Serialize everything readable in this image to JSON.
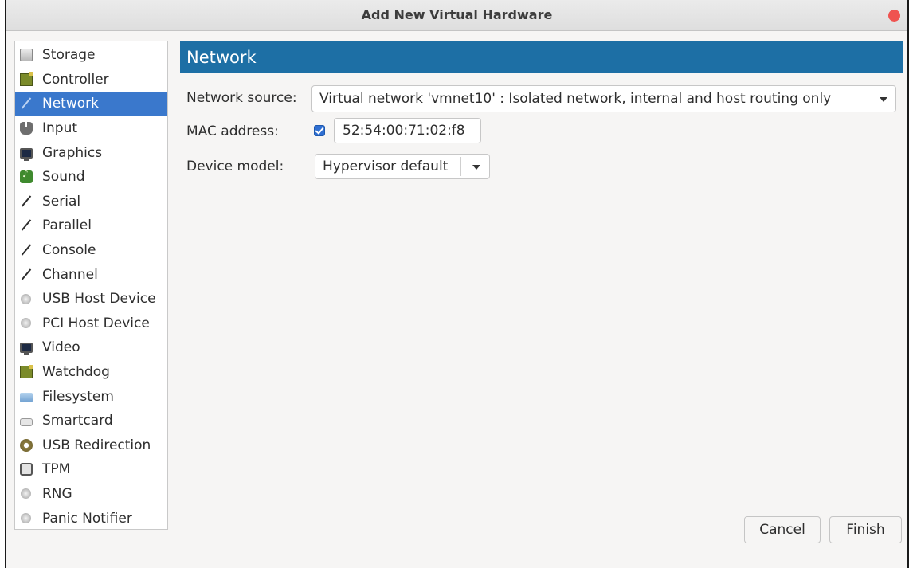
{
  "window": {
    "title": "Add New Virtual Hardware",
    "close_color": "#ef5350"
  },
  "sidebar": {
    "items": [
      {
        "label": "Storage",
        "icon": "storage-icon",
        "selected": false
      },
      {
        "label": "Controller",
        "icon": "controller-icon",
        "selected": false
      },
      {
        "label": "Network",
        "icon": "network-icon",
        "selected": true
      },
      {
        "label": "Input",
        "icon": "input-icon",
        "selected": false
      },
      {
        "label": "Graphics",
        "icon": "graphics-icon",
        "selected": false
      },
      {
        "label": "Sound",
        "icon": "sound-icon",
        "selected": false
      },
      {
        "label": "Serial",
        "icon": "serial-icon",
        "selected": false
      },
      {
        "label": "Parallel",
        "icon": "parallel-icon",
        "selected": false
      },
      {
        "label": "Console",
        "icon": "console-icon",
        "selected": false
      },
      {
        "label": "Channel",
        "icon": "channel-icon",
        "selected": false
      },
      {
        "label": "USB Host Device",
        "icon": "usb-host-device-icon",
        "selected": false
      },
      {
        "label": "PCI Host Device",
        "icon": "pci-host-device-icon",
        "selected": false
      },
      {
        "label": "Video",
        "icon": "video-icon",
        "selected": false
      },
      {
        "label": "Watchdog",
        "icon": "watchdog-icon",
        "selected": false
      },
      {
        "label": "Filesystem",
        "icon": "filesystem-icon",
        "selected": false
      },
      {
        "label": "Smartcard",
        "icon": "smartcard-icon",
        "selected": false
      },
      {
        "label": "USB Redirection",
        "icon": "usb-redirection-icon",
        "selected": false
      },
      {
        "label": "TPM",
        "icon": "tpm-icon",
        "selected": false
      },
      {
        "label": "RNG",
        "icon": "rng-icon",
        "selected": false
      },
      {
        "label": "Panic Notifier",
        "icon": "panic-notifier-icon",
        "selected": false
      }
    ]
  },
  "main": {
    "header": "Network",
    "network_source": {
      "label": "Network source:",
      "value": "Virtual network 'vmnet10' : Isolated network, internal and host routing only"
    },
    "mac_address": {
      "label": "MAC address:",
      "checked": true,
      "value": "52:54:00:71:02:f8"
    },
    "device_model": {
      "label": "Device model:",
      "value": "Hypervisor default"
    }
  },
  "buttons": {
    "cancel": "Cancel",
    "finish": "Finish"
  },
  "colors": {
    "accent": "#1d6fa5",
    "selection": "#3a78cc",
    "checkbox": "#2f6fd2"
  }
}
